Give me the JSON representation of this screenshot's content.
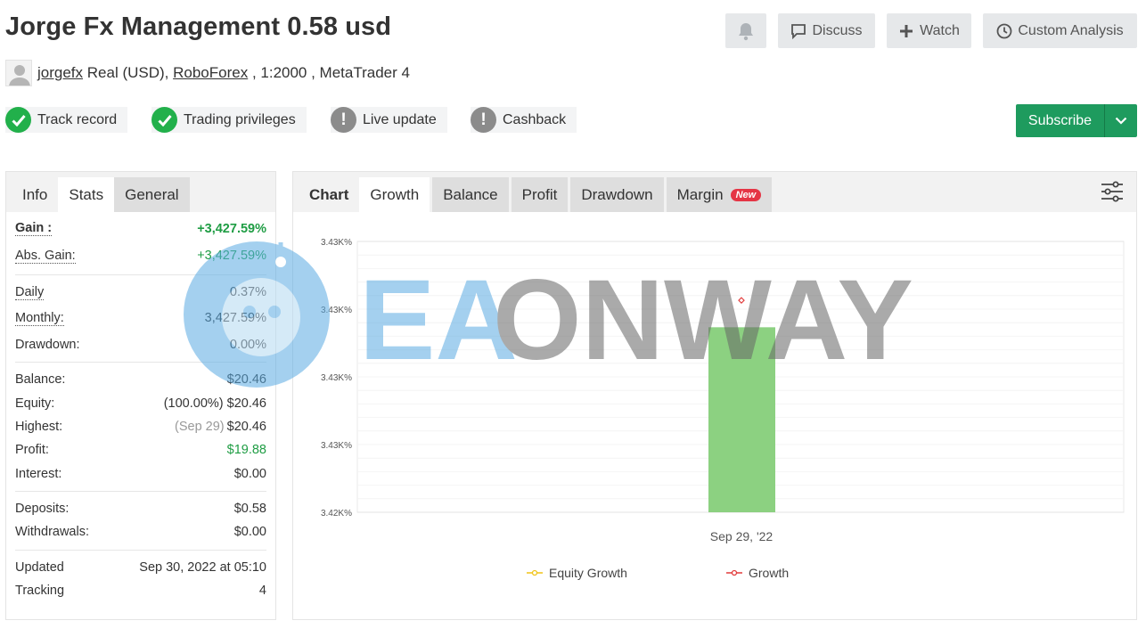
{
  "header": {
    "title": "Jorge Fx Management 0.58 usd",
    "discuss_label": "Discuss",
    "watch_label": "Watch",
    "analysis_label": "Custom Analysis"
  },
  "account": {
    "user": "jorgefx",
    "type": " Real (USD), ",
    "broker": "RoboForex",
    "details": " , 1:2000 , MetaTrader 4"
  },
  "badges": {
    "track": "Track record",
    "priv": "Trading privileges",
    "live": "Live update",
    "cash": "Cashback"
  },
  "subscribe_label": "Subscribe",
  "left_tabs": [
    "Info",
    "Stats",
    "General"
  ],
  "stats": {
    "gain_label": "Gain :",
    "gain": "+3,427.59%",
    "abs_label": "Abs. Gain:",
    "abs": "+3,427.59%",
    "daily_label": "Daily",
    "daily": "0.37%",
    "monthly_label": "Monthly:",
    "monthly": "3,427.59%",
    "dd_label": "Drawdown:",
    "dd": "0.00%",
    "balance_label": "Balance:",
    "balance": "$20.46",
    "equity_label": "Equity:",
    "equity_pct": "(100.00%)",
    "equity": "$20.46",
    "highest_label": "Highest:",
    "highest_date": "(Sep 29)",
    "highest": "$20.46",
    "profit_label": "Profit:",
    "profit": "$19.88",
    "interest_label": "Interest:",
    "interest": "$0.00",
    "deposits_label": "Deposits:",
    "deposits": "$0.58",
    "withdrawals_label": "Withdrawals:",
    "withdrawals": "$0.00",
    "updated_label": "Updated",
    "updated": "Sep 30, 2022 at 05:10",
    "tracking_label": "Tracking",
    "tracking": "4"
  },
  "right_tabs": {
    "chart": "Chart",
    "growth": "Growth",
    "balance": "Balance",
    "profit": "Profit",
    "drawdown": "Drawdown",
    "margin": "Margin",
    "new": "New"
  },
  "watermark": {
    "text_blue": "EA",
    "text_grey": "ONWAY"
  },
  "colors": {
    "green": "#1f9d44",
    "bar": "#86cf7a",
    "subscribe": "#1e9b5e",
    "equity_line": "#f0c419",
    "growth_line": "#e23b3b"
  },
  "chart_data": {
    "type": "bar",
    "categories": [
      "Sep 29, '22"
    ],
    "ytick_labels": [
      "3.42K%",
      "3.43K%",
      "3.43K%",
      "3.43K%",
      "3.43K%"
    ],
    "ylim": [
      3420,
      3432
    ],
    "series": [
      {
        "name": "Equity Growth",
        "values": [
          3427.59
        ]
      },
      {
        "name": "Growth",
        "values": [
          3427.59
        ]
      }
    ],
    "legend_position": "bottom",
    "grid": true
  }
}
